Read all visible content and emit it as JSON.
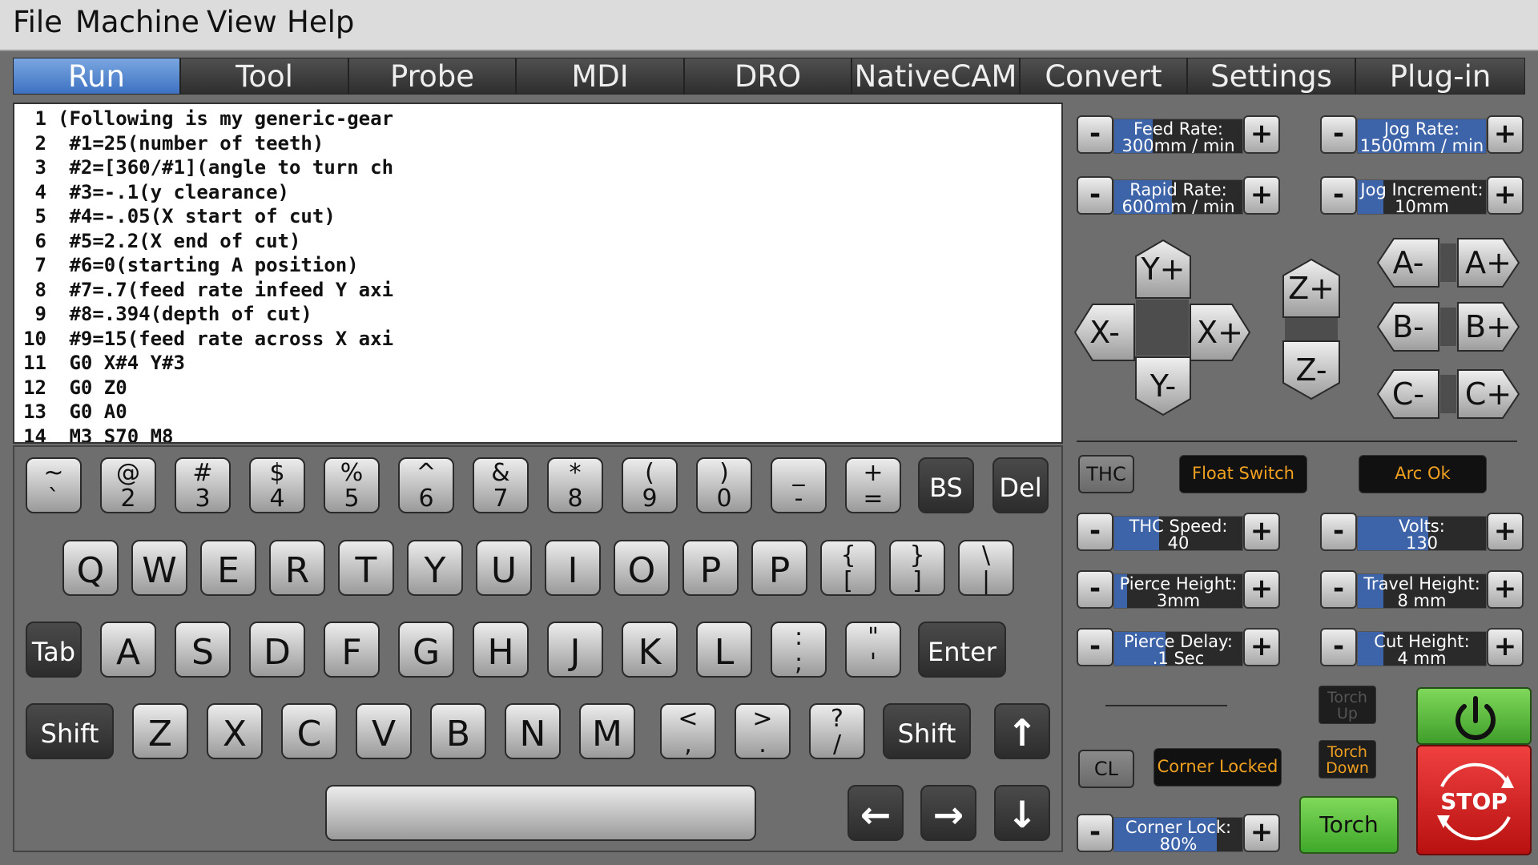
{
  "menu": {
    "file": "File",
    "machine": "Machine",
    "view": "View",
    "help": "Help"
  },
  "tabs": [
    "Run",
    "Tool",
    "Probe",
    "MDI",
    "DRO",
    "NativeCAM",
    "Convert",
    "Settings",
    "Plug-in"
  ],
  "editor": {
    "lines": [
      {
        "n": "1",
        "t": "(Following is my generic-gear"
      },
      {
        "n": "2",
        "t": " #1=25(number of teeth)"
      },
      {
        "n": "3",
        "t": " #2=[360/#1](angle to turn ch"
      },
      {
        "n": "4",
        "t": " #3=-.1(y clearance)"
      },
      {
        "n": "5",
        "t": " #4=-.05(X start of cut)"
      },
      {
        "n": "6",
        "t": " #5=2.2(X end of cut)"
      },
      {
        "n": "7",
        "t": " #6=0(starting A position)"
      },
      {
        "n": "8",
        "t": " #7=.7(feed rate infeed Y axi"
      },
      {
        "n": "9",
        "t": " #8=.394(depth of cut)"
      },
      {
        "n": "10",
        "t": " #9=15(feed rate across X axi"
      },
      {
        "n": "11",
        "t": " G0 X#4 Y#3"
      },
      {
        "n": "12",
        "t": " G0 Z0"
      },
      {
        "n": "13",
        "t": " G0 A0"
      },
      {
        "n": "14",
        "t": " M3 S70 M8"
      }
    ]
  },
  "keyboard": {
    "row1": [
      {
        "top": "~",
        "bot": "`"
      },
      {
        "top": "@",
        "bot": "2"
      },
      {
        "top": "#",
        "bot": "3"
      },
      {
        "top": "$",
        "bot": "4"
      },
      {
        "top": "%",
        "bot": "5"
      },
      {
        "top": "^",
        "bot": "6"
      },
      {
        "top": "&",
        "bot": "7"
      },
      {
        "top": "*",
        "bot": "8"
      },
      {
        "top": "(",
        "bot": "9"
      },
      {
        "top": ")",
        "bot": "0"
      },
      {
        "top": "_",
        "bot": "-"
      },
      {
        "top": "+",
        "bot": "="
      }
    ],
    "bs": "BS",
    "del": "Del",
    "row2": [
      "Q",
      "W",
      "E",
      "R",
      "T",
      "Y",
      "U",
      "I",
      "O",
      "P",
      "P"
    ],
    "row2sym": [
      {
        "top": "{",
        "bot": "["
      },
      {
        "top": "}",
        "bot": "]"
      },
      {
        "top": "\\",
        "bot": "|"
      }
    ],
    "tab": "Tab",
    "row3": [
      "A",
      "S",
      "D",
      "F",
      "G",
      "H",
      "J",
      "K",
      "L"
    ],
    "row3sym": [
      {
        "top": ":",
        "bot": ";"
      },
      {
        "top": "\"",
        "bot": "'"
      }
    ],
    "enter": "Enter",
    "shift": "Shift",
    "row4": [
      "Z",
      "X",
      "C",
      "V",
      "B",
      "N",
      "M"
    ],
    "row4sym": [
      {
        "top": "<",
        "bot": ","
      },
      {
        "top": ">",
        "bot": "."
      },
      {
        "top": "?",
        "bot": "/"
      }
    ],
    "arrows": {
      "up": "↑",
      "left": "←",
      "right": "→",
      "down": "↓"
    }
  },
  "rates": {
    "feed": {
      "label": "Feed Rate:",
      "value": "300mm / min",
      "level": 0.3
    },
    "jog": {
      "label": "Jog Rate:",
      "value": "1500mm / min",
      "level": 1.0
    },
    "rapid": {
      "label": "Rapid Rate:",
      "value": "600mm / min",
      "level": 0.45
    },
    "jog_inc": {
      "label": "Jog Increment:",
      "value": "10mm",
      "level": 0.2
    },
    "minus": "-",
    "plus": "+"
  },
  "jog_buttons": {
    "y_plus": "Y+",
    "y_minus": "Y-",
    "x_minus": "X-",
    "x_plus": "X+",
    "z_plus": "Z+",
    "z_minus": "Z-",
    "a_minus": "A-",
    "a_plus": "A+",
    "b_minus": "B-",
    "b_plus": "B+",
    "c_minus": "C-",
    "c_plus": "C+"
  },
  "thc": {
    "thc_button": "THC",
    "float_switch": "Float Switch",
    "arc_ok": "Arc Ok",
    "thc_speed": {
      "label": "THC Speed:",
      "value": "40",
      "level": 0.35
    },
    "volts": {
      "label": "Volts:",
      "value": "130",
      "level": 0.55
    },
    "pierce_height": {
      "label": "Pierce Height:",
      "value": "3mm",
      "level": 0.1
    },
    "travel_height": {
      "label": "Travel Height:",
      "value": "8 mm",
      "level": 0.2
    },
    "pierce_delay": {
      "label": "Pierce Delay:",
      "value": ".1 Sec",
      "level": 0.4
    },
    "cut_height": {
      "label": "Cut Height:",
      "value": "4 mm",
      "level": 0.2
    },
    "torch_up": "Torch Up",
    "torch_down": "Torch Down",
    "cl": "CL",
    "corner_locked": "Corner Locked",
    "corner_lock": {
      "label": "Corner Lock:",
      "value": "80%",
      "level": 0.8
    },
    "torch": "Torch",
    "stop": "STOP"
  },
  "colors": {
    "accent": "#3d72c2",
    "amber": "#f0a020",
    "green": "#55c23a",
    "red": "#d81c1c"
  }
}
